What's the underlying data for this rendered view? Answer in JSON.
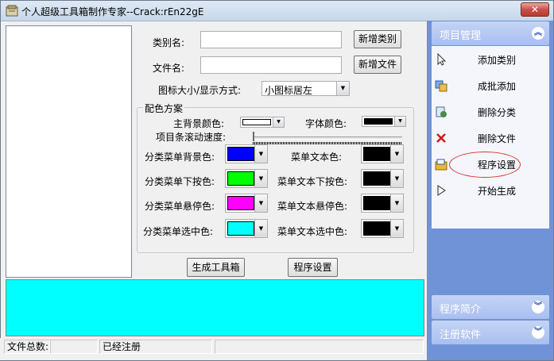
{
  "window": {
    "title": "个人超级工具箱制作专家--Crack:rEn22gE",
    "close": "✕"
  },
  "form": {
    "category_label": "类别名:",
    "category_value": "",
    "add_category_btn": "新增类别",
    "file_label": "文件名:",
    "file_value": "",
    "add_file_btn": "新增文件",
    "icon_mode_label": "图标大小/显示方式:",
    "icon_mode_value": "小图标居左"
  },
  "colors": {
    "group_title": "配色方案",
    "main_bg_label": "主背景颜色:",
    "main_bg_color": "#ffffff",
    "font_color_label": "字体颜色:",
    "font_color": "#000000",
    "scroll_speed_label": "项目条滚动速度:",
    "rows": [
      {
        "left_label": "分类菜单背景色:",
        "left_color": "#0000ff",
        "right_label": "菜单文本色:",
        "right_color": "#000000"
      },
      {
        "left_label": "分类菜单下按色:",
        "left_color": "#00ff00",
        "right_label": "菜单文本下按色:",
        "right_color": "#000000"
      },
      {
        "left_label": "分类菜单悬停色:",
        "left_color": "#ff00ff",
        "right_label": "菜单文本悬停色:",
        "right_color": "#000000"
      },
      {
        "left_label": "分类菜单选中色:",
        "left_color": "#00ffff",
        "right_label": "菜单文本选中色:",
        "right_color": "#000000"
      }
    ]
  },
  "actions": {
    "generate_btn": "生成工具箱",
    "settings_btn": "程序设置"
  },
  "log_area": {
    "background": "#00ffff"
  },
  "status": {
    "file_count_label": "文件总数:",
    "file_count_value": "",
    "reg_status": "已经注册",
    "extra": ""
  },
  "panel": {
    "project_header": "项目管理",
    "items": [
      {
        "label": "添加类别",
        "icon": "cursor-icon"
      },
      {
        "label": "成批添加",
        "icon": "batch-add-icon"
      },
      {
        "label": "删除分类",
        "icon": "delete-category-icon"
      },
      {
        "label": "删除文件",
        "icon": "delete-file-icon"
      },
      {
        "label": "程序设置",
        "icon": "settings-icon"
      },
      {
        "label": "开始生成",
        "icon": "play-icon"
      }
    ],
    "intro_header": "程序简介",
    "register_header": "注册软件"
  }
}
